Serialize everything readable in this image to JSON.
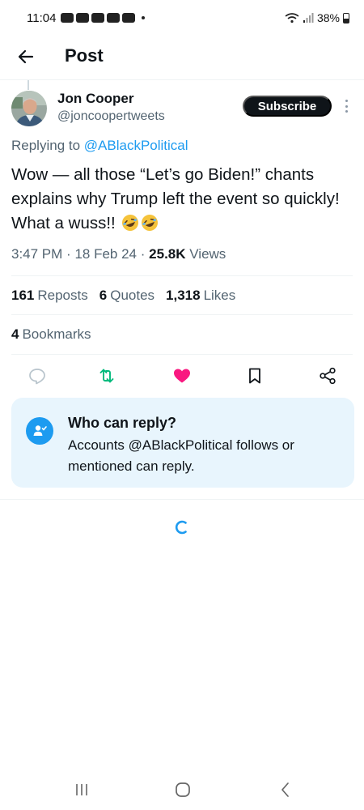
{
  "status_bar": {
    "time": "11:04",
    "battery": "38%"
  },
  "header": {
    "title": "Post"
  },
  "post": {
    "author_name": "Jon Cooper",
    "author_handle": "@joncoopertweets",
    "subscribe_label": "Subscribe",
    "replying_prefix": "Replying to",
    "replying_to": "@ABlackPolitical",
    "text": "Wow — all those “Let’s go Biden!” chants explains why Trump left the event so quickly! What a wuss!!",
    "time": "3:47 PM",
    "date": "18 Feb 24",
    "views_count": "25.8K",
    "views_label": "Views",
    "separator": "·"
  },
  "stats": {
    "reposts_count": "161",
    "reposts_label": "Reposts",
    "quotes_count": "6",
    "quotes_label": "Quotes",
    "likes_count": "1,318",
    "likes_label": "Likes",
    "bookmarks_count": "4",
    "bookmarks_label": "Bookmarks"
  },
  "reply_settings": {
    "title": "Who can reply?",
    "body": "Accounts @ABlackPolitical follows or mentioned can reply."
  },
  "icons": {
    "back": "arrow-left-icon",
    "reply": "reply-bubble-icon",
    "repost": "repost-icon",
    "like": "heart-icon",
    "bookmark": "bookmark-icon",
    "share": "share-icon",
    "emoji": "rolling-on-floor-laughing-emoji"
  },
  "colors": {
    "accent": "#1d9bf0",
    "repost_active": "#00ba7c",
    "like_active": "#f91880",
    "card_bg": "#e8f5fd"
  }
}
